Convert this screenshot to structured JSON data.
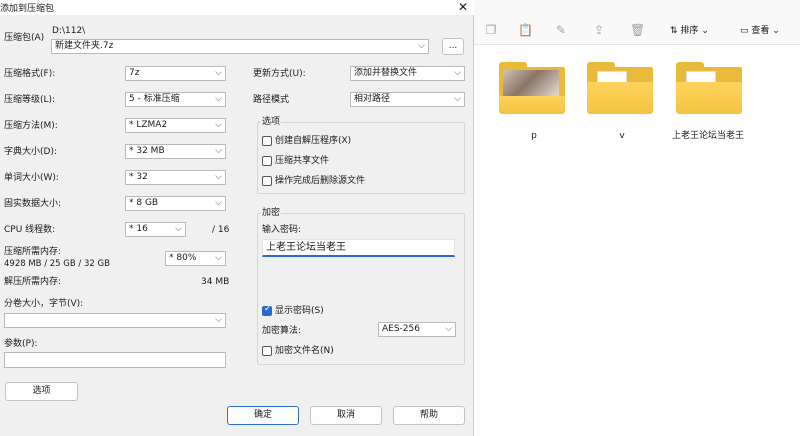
{
  "dialog": {
    "title": "添加到压缩包",
    "close_glyph": "✕",
    "archive": {
      "label": "压缩包(A)",
      "path": "D:\\112\\",
      "filename": "新建文件夹.7z",
      "browse_label": "..."
    },
    "format": {
      "label": "压缩格式(F):",
      "value": "7z"
    },
    "level": {
      "label": "压缩等级(L):",
      "value": "5 - 标准压缩"
    },
    "method": {
      "label": "压缩方法(M):",
      "value": "* LZMA2"
    },
    "dict": {
      "label": "字典大小(D):",
      "value": "* 32 MB"
    },
    "word": {
      "label": "单词大小(W):",
      "value": "* 32"
    },
    "solid": {
      "label": "固实数据大小:",
      "value": "* 8 GB"
    },
    "cpu": {
      "label": "CPU 线程数:",
      "value": "* 16",
      "total": "/ 16"
    },
    "mem_compress": {
      "label": "压缩所需内存:",
      "detail": "4928 MB / 25 GB / 32 GB",
      "value": "* 80%"
    },
    "mem_decompress": {
      "label": "解压所需内存:",
      "value": "34 MB"
    },
    "split": {
      "label": "分卷大小，字节(V):",
      "value": ""
    },
    "params": {
      "label": "参数(P):",
      "value": ""
    },
    "options_button": "选项",
    "update": {
      "label": "更新方式(U):",
      "value": "添加并替换文件"
    },
    "path_mode": {
      "label": "路径模式",
      "value": "相对路径"
    },
    "options_group": {
      "title": "选项",
      "sfx": {
        "label": "创建自解压程序(X)",
        "checked": false
      },
      "shared": {
        "label": "压缩共享文件",
        "checked": false
      },
      "delete": {
        "label": "操作完成后删除源文件",
        "checked": false
      }
    },
    "encryption": {
      "title": "加密",
      "password_label": "输入密码:",
      "password_value": "上老王论坛当老王",
      "show_password": {
        "label": "显示密码(S)",
        "checked": true
      },
      "method_label": "加密算法:",
      "method_value": "AES-256",
      "encrypt_names": {
        "label": "加密文件名(N)",
        "checked": false
      }
    },
    "ok": "确定",
    "cancel": "取消",
    "help": "帮助"
  },
  "explorer": {
    "sort_label": "排序",
    "view_label": "查看",
    "items": [
      {
        "name": "p",
        "kind": "photo-folder"
      },
      {
        "name": "v",
        "kind": "doc-folder"
      },
      {
        "name": "上老王论坛当老王",
        "kind": "doc-folder"
      }
    ]
  }
}
